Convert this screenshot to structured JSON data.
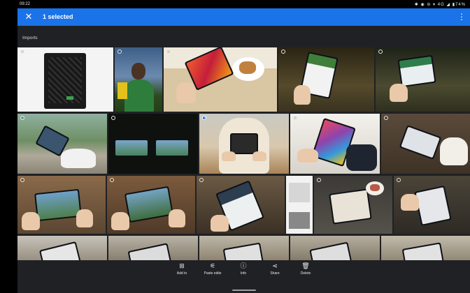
{
  "status_bar": {
    "time": "09:22",
    "icons_text": "✱ ◉ ⊖ ▾ 4G ◢ ▮74%"
  },
  "app_bar": {
    "title": "1 selected",
    "close_icon": "close-icon",
    "more_icon": "more-vert-icon"
  },
  "section": {
    "title": "Imports"
  },
  "bottom_actions": [
    {
      "label": "Add to",
      "icon": "add-to-icon"
    },
    {
      "label": "Paste edits",
      "icon": "paste-edits-icon"
    },
    {
      "label": "Info",
      "icon": "info-icon"
    },
    {
      "label": "Share",
      "icon": "share-icon"
    },
    {
      "label": "Delete",
      "icon": "delete-icon"
    }
  ],
  "colors": {
    "accent": "#1a73e8",
    "background": "#202124"
  }
}
